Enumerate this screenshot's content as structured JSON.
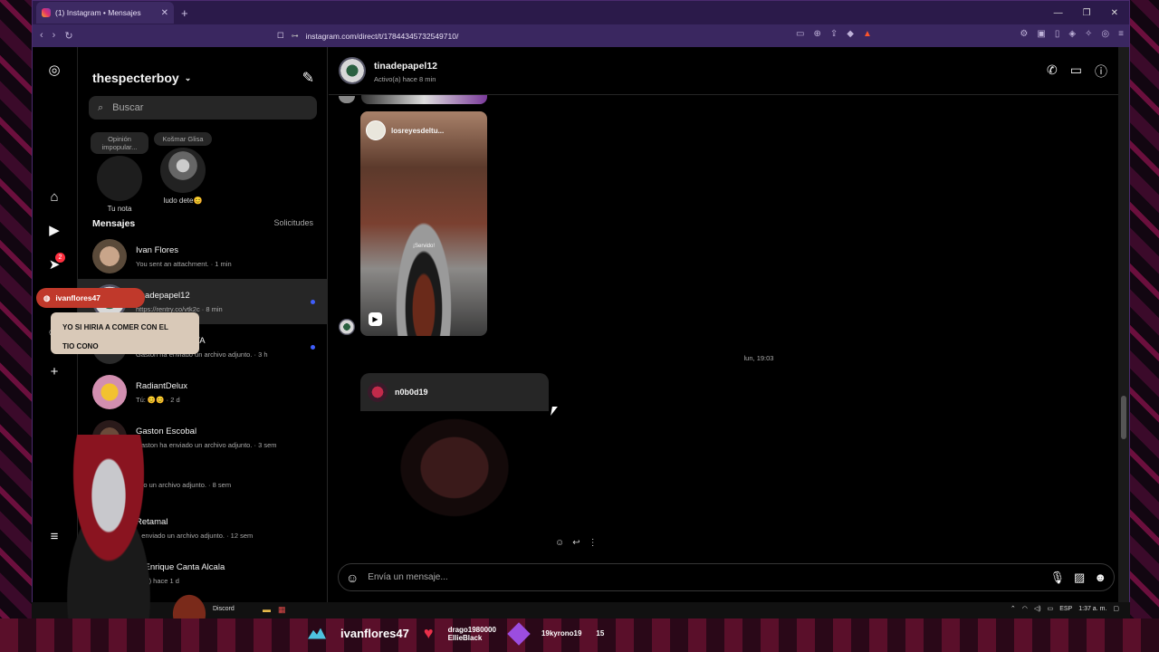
{
  "browser": {
    "tab_title": "(1) Instagram • Mensajes",
    "url": "instagram.com/direct/t/17844345732549710/"
  },
  "sidebar": {
    "username": "thespecterboy",
    "search_placeholder": "Buscar",
    "notes": [
      {
        "bubble": "Opinión impopular...",
        "name": "Tu nota"
      },
      {
        "bubble": "Košmar Glisa",
        "name": "ludo dete😊"
      }
    ],
    "section_title": "Mensajes",
    "requests_label": "Solicitudes",
    "conversations": [
      {
        "name": "Ivan Flores",
        "preview": "You sent an attachment. · 1 min",
        "unread": false
      },
      {
        "name": "tinadepapel12",
        "preview": "https://rentry.co/vtk2c · 8 min",
        "unread": true
      },
      {
        "name": "ARCA DEL INSTA",
        "preview": "Gaston ha enviado un archivo adjunto. · 3 h",
        "unread": true
      },
      {
        "name": "RadiantDelux",
        "preview": "Tú: 😊😊 · 2 d",
        "unread": false
      },
      {
        "name": "Gaston Escobal",
        "preview": "Gaston ha enviado un archivo adjunto. · 3 sem",
        "unread": false
      },
      {
        "name": "",
        "preview": "ado un archivo adjunto. · 8 sem",
        "unread": false
      },
      {
        "name": "Retamal",
        "preview": "a enviado un archivo adjunto. · 12 sem",
        "unread": false
      },
      {
        "name": "is Enrique Canta Alcala",
        "preview": "vo(a) hace 1 d",
        "unread": false
      }
    ],
    "notification_count": "2"
  },
  "chat": {
    "contact_name": "tinadepapel12",
    "status": "Activo(a) hace 8 min",
    "reel_account": "losreyesdeltu...",
    "reel_caption": "¡Servido!",
    "timestamp": "lun, 19:03",
    "shared_account": "n0b0d19",
    "composer_placeholder": "Envía un mensaje..."
  },
  "taskbar": {
    "discord_label": "Discord",
    "lang": "ESP",
    "time": "1:37 a. m."
  },
  "overlay": {
    "alert_user": "ivanflores47",
    "alert_message_line1": "YO SI HIRIA A COMER CON EL",
    "alert_message_line2": "TIO CONO",
    "stream_username": "ivanflores47",
    "stream_donor_1": "drago1980000",
    "stream_donor_2": "EllieBlack",
    "stream_follower": "19kyrono19",
    "stream_count": "15"
  }
}
